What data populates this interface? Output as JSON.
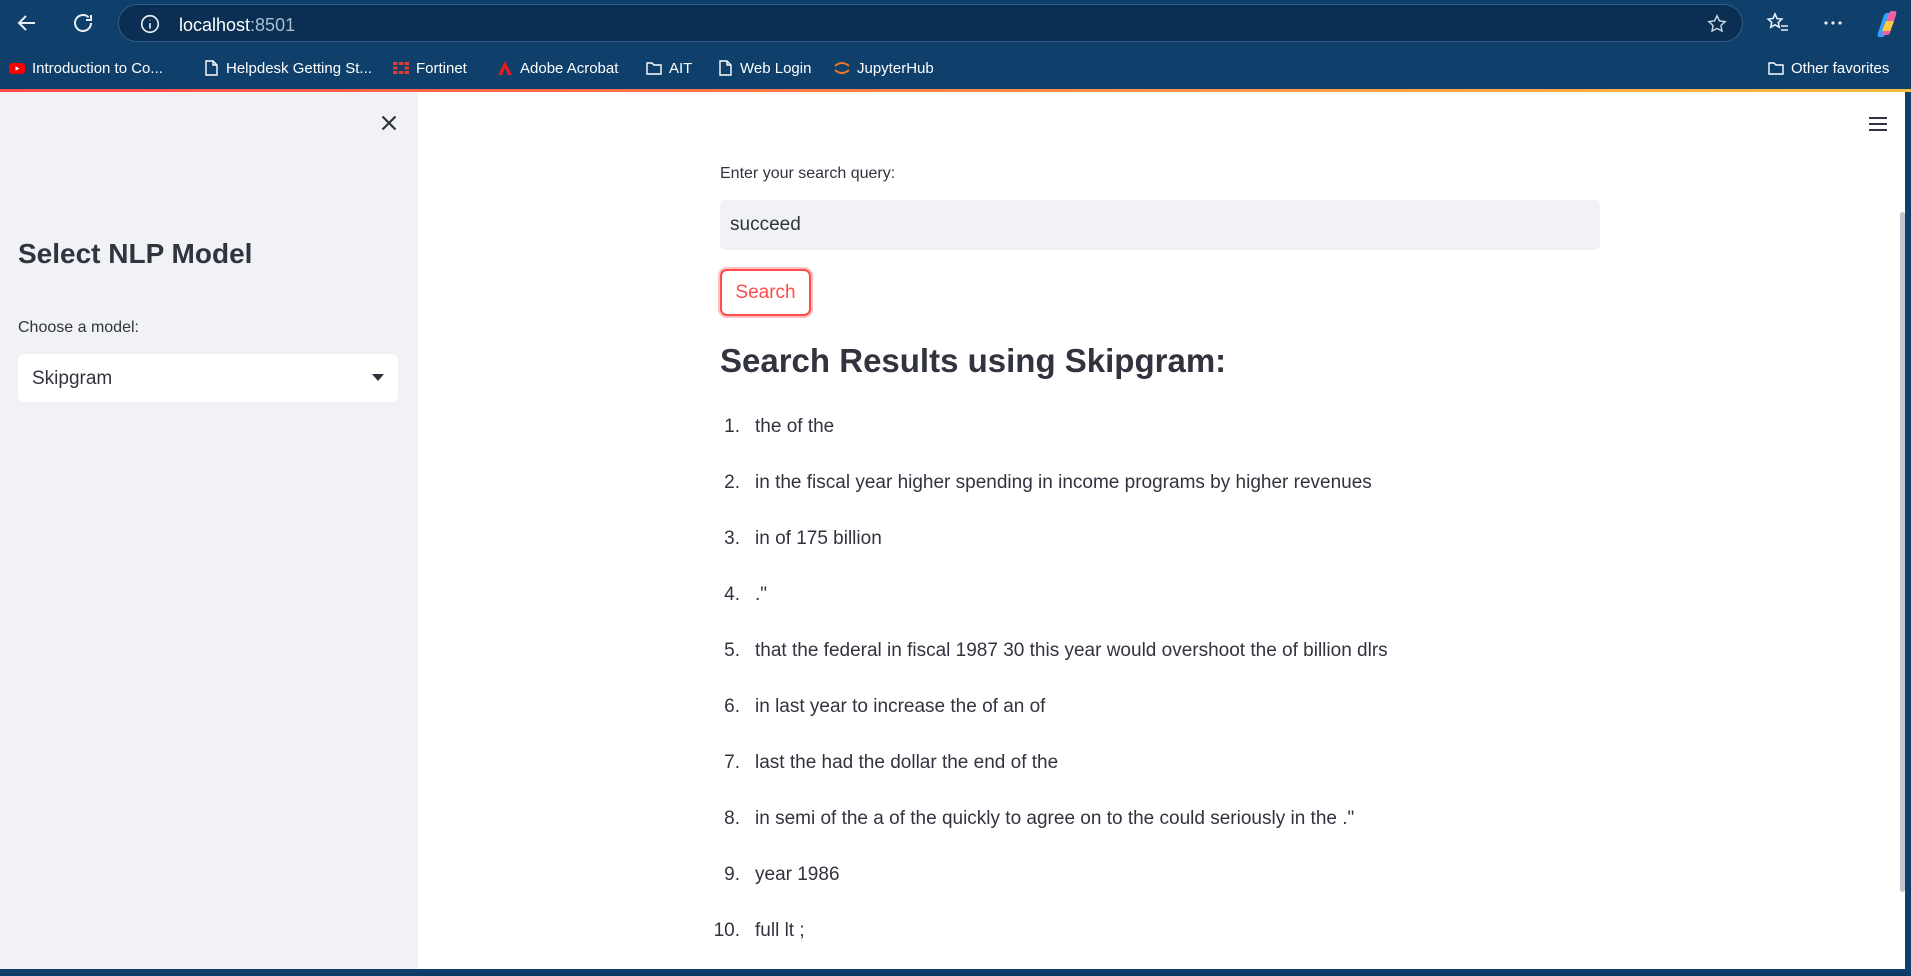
{
  "browser": {
    "url_host": "localhost",
    "url_port": ":8501",
    "bookmarks": [
      {
        "label": "Introduction to Co...",
        "icon": "youtube-icon"
      },
      {
        "label": "Helpdesk Getting St...",
        "icon": "page-icon"
      },
      {
        "label": "Fortinet",
        "icon": "fortinet-icon"
      },
      {
        "label": "Adobe Acrobat",
        "icon": "acrobat-icon"
      },
      {
        "label": "AIT",
        "icon": "folder-icon"
      },
      {
        "label": "Web Login",
        "icon": "page-icon"
      },
      {
        "label": "JupyterHub",
        "icon": "jupyter-icon"
      }
    ],
    "other_favorites": "Other favorites"
  },
  "sidebar": {
    "title": "Select NLP Model",
    "model_label": "Choose a model:",
    "model_selected": "Skipgram"
  },
  "main": {
    "query_label": "Enter your search query:",
    "query_value": "succeed",
    "search_button": "Search",
    "results_title": "Search Results using Skipgram:",
    "results": [
      {
        "num": "1.",
        "text": "the of the"
      },
      {
        "num": "2.",
        "text": "in the fiscal year higher spending in income programs by higher revenues"
      },
      {
        "num": "3.",
        "text": "in of 175 billion"
      },
      {
        "num": "4.",
        "text": ".\""
      },
      {
        "num": "5.",
        "text": "that the federal in fiscal 1987 30 this year would overshoot the of billion dlrs"
      },
      {
        "num": "6.",
        "text": "in last year to increase the of an of"
      },
      {
        "num": "7.",
        "text": "last the had the dollar the end of the"
      },
      {
        "num": "8.",
        "text": "in semi of the a of the quickly to agree on to the could seriously in the .\""
      },
      {
        "num": "9.",
        "text": "year 1986"
      },
      {
        "num": "10.",
        "text": "full lt ;"
      }
    ]
  },
  "colors": {
    "accent": "#ff4b4b",
    "chrome": "#0f3f6b",
    "sidebar_bg": "#f0f2f6",
    "text": "#31333f"
  }
}
